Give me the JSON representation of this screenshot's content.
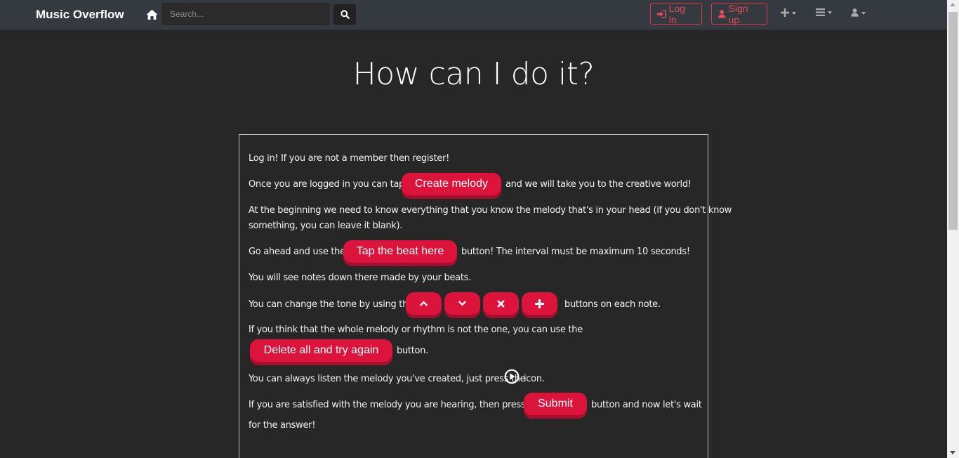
{
  "navbar": {
    "brand": "Music Overflow",
    "search_placeholder": "Search...",
    "login_label": "Log in",
    "signup_label": "Sign up"
  },
  "page": {
    "title": "How can I do it?"
  },
  "instructions": {
    "line1": "Log in! If you are not a member then register!",
    "line2_pre": "Once you are logged in you can tap",
    "create_melody_label": "Create melody",
    "line2_post": "and we will take you to the creative world!",
    "line3a": "At the beginning we need to know everything that you know the melody that's in your head (if you don't know",
    "line3b": "something, you can leave it blank).",
    "line4_pre": "Go ahead and use the",
    "tap_beat_label": "Tap the beat here",
    "line4_post": "button! The interval must be maximum 10 seconds!",
    "line5": "You will see notes down there made by your beats.",
    "line6_pre": "You can change the tone by using the",
    "line6_post": "buttons on each note.",
    "line7": "If you think that the whole melody or rhythm is not the one, you can use the",
    "delete_all_label": "Delete all and try again",
    "line8_post": "button.",
    "line9_pre": "You can always listen the melody you've created, just press the",
    "line9_post": "icon.",
    "line10_pre": "If you are satisfied with the melody you are hearing, then press the",
    "submit_label": "Submit",
    "line10_post": "button and now let's wait",
    "line11": "for the answer!"
  },
  "colors": {
    "accent": "#dc143c",
    "accent_shadow": "#a50f2d",
    "navbar_bg": "#343a40",
    "page_bg": "#272727"
  },
  "icons": [
    "home-icon",
    "search-icon",
    "sign-in-icon",
    "user-icon",
    "plus-icon",
    "bars-icon",
    "chevron-up-icon",
    "chevron-down-icon",
    "times-icon",
    "play-circle-icon"
  ]
}
